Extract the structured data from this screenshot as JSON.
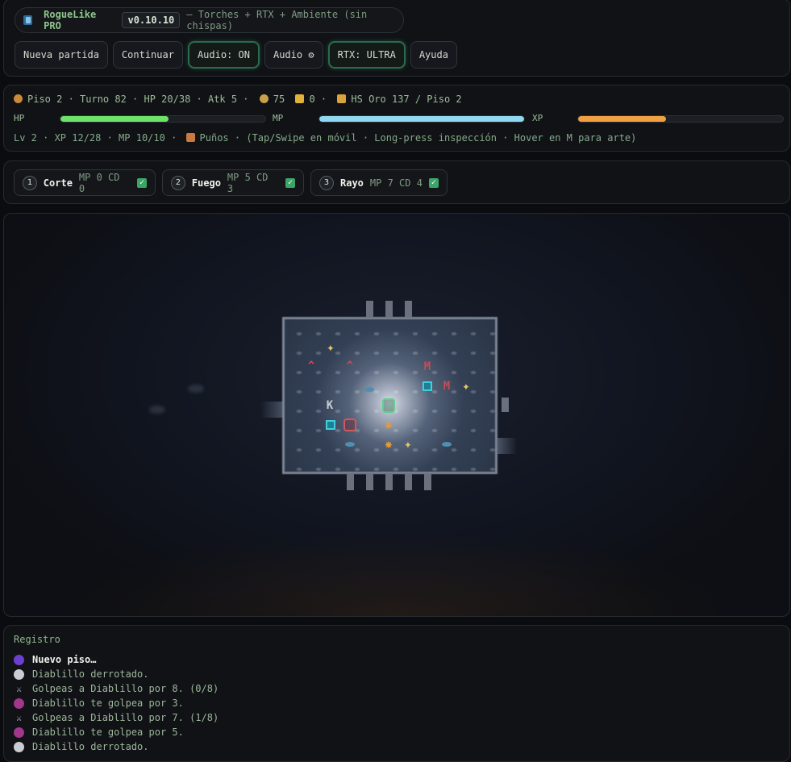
{
  "header": {
    "app_name": "RogueLike PRO",
    "version": "v0.10.10",
    "subtitle": "— Torches + RTX + Ambiente (sin chispas)",
    "buttons": [
      {
        "label": "Nueva partida"
      },
      {
        "label": "Continuar"
      },
      {
        "label": "Audio: ON"
      },
      {
        "label": "Audio ⚙"
      },
      {
        "label": "RTX: ULTRA"
      },
      {
        "label": "Ayuda"
      }
    ]
  },
  "stats": {
    "line1": "Piso 2 · Turno 82 · HP 20/38 · Atk 5 ·",
    "gold": "75",
    "keys": "0 ·",
    "highscore": "HS Oro 137 / Piso 2",
    "hp_label": "HP",
    "mp_label": "MP",
    "xp_label": "XP",
    "hp_fraction": 0.526,
    "mp_fraction": 1.0,
    "xp_fraction": 0.43,
    "colors": {
      "hp": "#6ee36a",
      "mp": "#8fd8f0",
      "xp": "#f0a040"
    },
    "line2_a": "Lv 2 · XP 12/28 · MP 10/10 ·",
    "line2_b": "Puños · (Tap/Swipe en móvil · Long-press inspección · Hover en M para arte)"
  },
  "skills": [
    {
      "num": "1",
      "name": "Corte",
      "cost": "MP 0  CD 0"
    },
    {
      "num": "2",
      "name": "Fuego",
      "cost": "MP 5  CD 3"
    },
    {
      "num": "3",
      "name": "Rayo",
      "cost": "MP 7  CD 4"
    }
  ],
  "map": {
    "glyphs": {
      "star": "✦",
      "monster": "M",
      "trap": "^",
      "key": "K",
      "fire": "✸"
    }
  },
  "log": {
    "title": "Registro",
    "entries": [
      {
        "icon": "spiral-icon",
        "text": "Nuevo piso…"
      },
      {
        "icon": "skull-icon",
        "text": "Diablillo derrotado."
      },
      {
        "icon": "swords-icon",
        "text": "Golpeas a Diablillo por 8. (0/8)"
      },
      {
        "icon": "devil-icon",
        "text": "Diablillo te golpea por 3."
      },
      {
        "icon": "swords-icon",
        "text": "Golpeas a Diablillo por 7. (1/8)"
      },
      {
        "icon": "devil-icon",
        "text": "Diablillo te golpea por 5."
      },
      {
        "icon": "skull-icon",
        "text": "Diablillo derrotado."
      }
    ]
  }
}
